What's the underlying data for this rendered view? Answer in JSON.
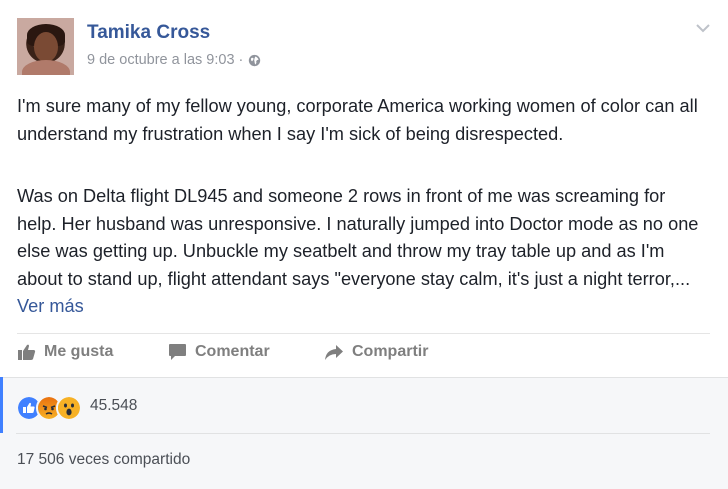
{
  "post": {
    "author": "Tamika Cross",
    "timestamp": "9 de octubre a las 9:03",
    "separator": "·",
    "privacy_icon": "globe-icon",
    "paragraph1": "I'm sure many of my fellow young, corporate America working women of color can all understand my frustration when I say I'm sick of being disrespected.",
    "paragraph2": "Was on Delta flight DL945 and someone 2 rows in front of me was screaming for help. Her husband was unresponsive. I naturally jumped into Doctor mode as no one else was getting up. Unbuckle my seatbelt and throw my tray table up and as I'm about to stand up, flight attendant says \"everyone stay calm, it's just a night terror,...",
    "see_more": "Ver más"
  },
  "actions": {
    "like": "Me gusta",
    "comment": "Comentar",
    "share": "Compartir"
  },
  "social": {
    "reactions": [
      "like",
      "angry",
      "wow"
    ],
    "reaction_count": "45.548",
    "shares": "17 506 veces compartido"
  },
  "colors": {
    "link": "#365899",
    "meta": "#90949c",
    "like": "#4080ff",
    "angry": "#e9710f",
    "wow": "#f7b125"
  }
}
